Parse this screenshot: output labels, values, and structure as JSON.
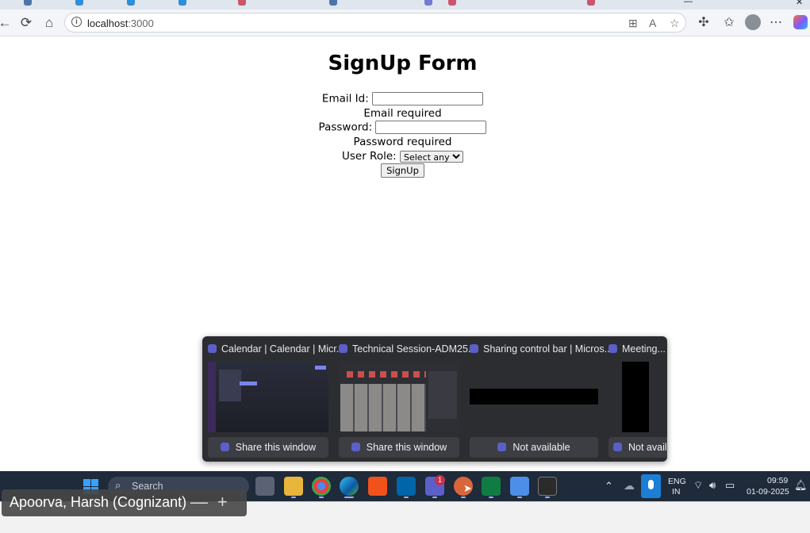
{
  "browser": {
    "url_host": "localhost",
    "url_port": ":3000",
    "icons": [
      "back-icon",
      "refresh-icon",
      "home-icon",
      "site-info-icon",
      "apps-icon",
      "read-aloud-icon",
      "favorite-star-icon",
      "extensions-icon",
      "favorites-icon",
      "profile-icon",
      "more-icon",
      "copilot-icon"
    ],
    "minimize_glyph": "—",
    "close_glyph": "✕"
  },
  "form": {
    "title": "SignUp Form",
    "email_label": "Email Id:",
    "email_value": "",
    "email_error": "Email required",
    "password_label": "Password:",
    "password_value": "",
    "password_error": "Password required",
    "role_label": "User Role:",
    "role_selected": "Select any",
    "submit_label": "SignUp"
  },
  "thumbnails": [
    {
      "title": "Calendar | Calendar | Micr...",
      "action": "Share this window"
    },
    {
      "title": "Technical Session-ADM25...",
      "action": "Share this window"
    },
    {
      "title": "Sharing control bar | Micros...",
      "action": "Not available"
    },
    {
      "title": "Meeting...",
      "action": "Not availa"
    }
  ],
  "taskbar": {
    "search_placeholder": "Search",
    "apps": [
      "task-view",
      "file-explorer",
      "chrome",
      "edge",
      "microsoft-store",
      "vscode",
      "teams",
      "app-orange",
      "excel",
      "notepad",
      "terminal"
    ],
    "teams_badge": "1",
    "lang_line1": "ENG",
    "lang_line2": "IN",
    "time": "09:59",
    "date": "01-09-2025"
  },
  "call": {
    "participant": "Apoorva, Harsh (Cognizant)",
    "minimize_glyph": "—",
    "add_glyph": "+"
  }
}
